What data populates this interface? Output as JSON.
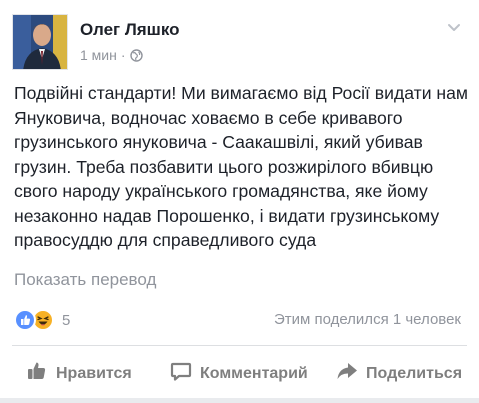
{
  "post": {
    "author": "Олег Ляшко",
    "time": "1 мин",
    "time_separator": "·",
    "body": "Подвійні стандарти! Ми вимагаємо від Росії видати нам Януковича, водночас ховаємо в себе кривавого грузинського януковича - Саакашвілі, який убивав грузин. Треба позбавити цього розжирілого вбивцю свого народу українського громадянства, яке йому незаконно надав Порошенко, і видати грузинському правосуддю для справедливого суда",
    "translate_link": "Показать перевод",
    "reactions": {
      "icons": [
        "like-reaction-icon",
        "haha-reaction-icon"
      ],
      "count": "5"
    },
    "shares": "Этим поделился 1 человек"
  },
  "actions": {
    "like_label": "Нравится",
    "comment_label": "Комментарий",
    "share_label": "Поделиться"
  },
  "colors": {
    "text": "#1d2129",
    "meta": "#90949c",
    "like_blue": "#5890ff",
    "haha_yellow": "#f7b125",
    "action_grey": "#7f7f7f"
  }
}
